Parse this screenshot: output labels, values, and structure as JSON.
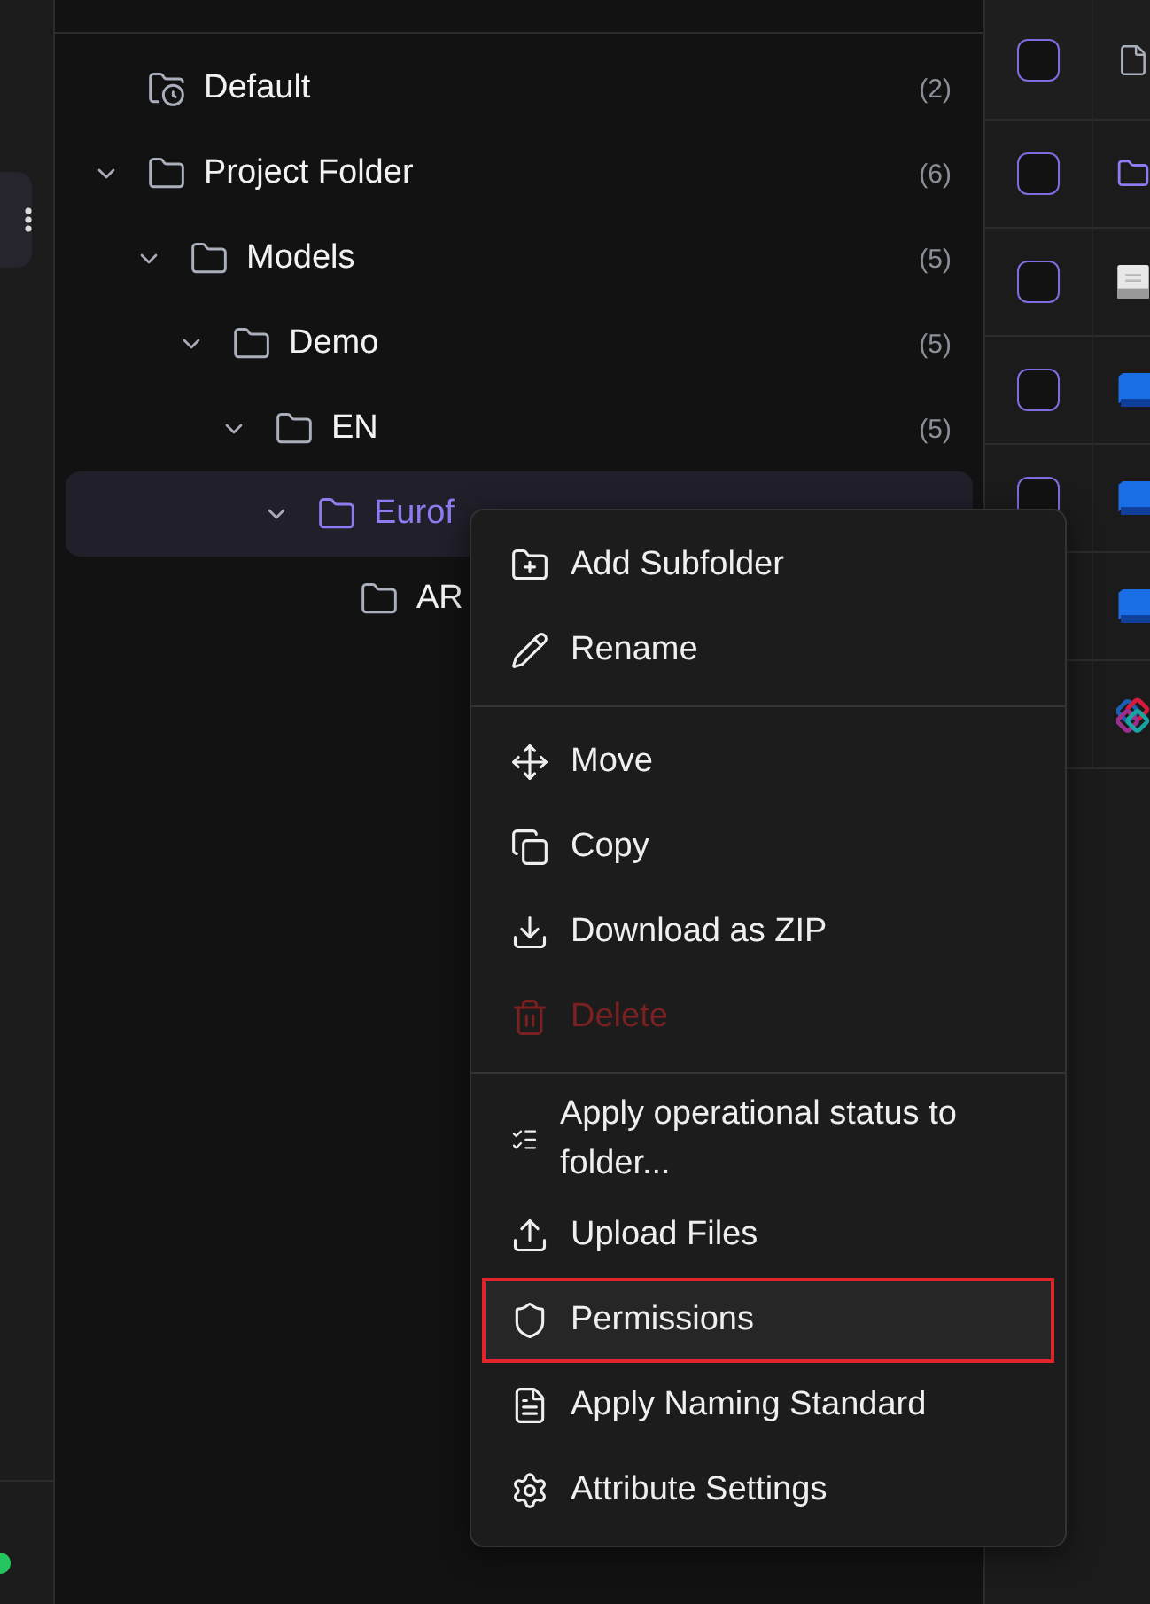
{
  "tree": [
    {
      "label": "Default",
      "count": "(2)",
      "kind": "recent",
      "selected": false
    },
    {
      "label": "Project Folder",
      "count": "(6)",
      "kind": "folder",
      "expanded": true,
      "selected": false,
      "children": [
        {
          "label": "Models",
          "count": "(5)",
          "kind": "folder",
          "expanded": true,
          "selected": false,
          "children": [
            {
              "label": "Demo",
              "count": "(5)",
              "kind": "folder",
              "expanded": true,
              "selected": false,
              "children": [
                {
                  "label": "EN",
                  "count": "(5)",
                  "kind": "folder",
                  "expanded": true,
                  "selected": false,
                  "children": [
                    {
                      "label": "Eurof",
                      "kind": "folder",
                      "expanded": true,
                      "selected": true,
                      "children": [
                        {
                          "label": "AR",
                          "kind": "folder",
                          "selected": false
                        }
                      ]
                    }
                  ]
                }
              ]
            }
          ]
        }
      ]
    }
  ],
  "context_menu": {
    "groups": [
      [
        {
          "label": "Add Subfolder",
          "disabled": false,
          "selected": false
        },
        {
          "label": "Rename",
          "disabled": false,
          "selected": false
        }
      ],
      [
        {
          "label": "Move",
          "disabled": false,
          "selected": false
        },
        {
          "label": "Copy",
          "disabled": false,
          "selected": false
        },
        {
          "label": "Download as ZIP",
          "disabled": false,
          "selected": false
        },
        {
          "label": "Delete",
          "disabled": true,
          "selected": false
        }
      ],
      [
        {
          "label": "Apply operational status to folder...",
          "disabled": false,
          "selected": false
        },
        {
          "label": "Upload Files",
          "disabled": false,
          "selected": false
        },
        {
          "label": "Permissions",
          "disabled": false,
          "selected": true
        },
        {
          "label": "Apply Naming Standard",
          "disabled": false,
          "selected": false
        },
        {
          "label": "Attribute Settings",
          "disabled": false,
          "selected": false
        }
      ]
    ]
  },
  "file_table": {
    "rows": [
      {
        "kind": "header",
        "checked": false
      },
      {
        "kind": "folder",
        "checked": false
      },
      {
        "kind": "text",
        "checked": false
      },
      {
        "kind": "badge",
        "checked": false
      },
      {
        "kind": "badge",
        "checked": false
      },
      {
        "kind": "badge"
      },
      {
        "kind": "logo"
      }
    ]
  }
}
